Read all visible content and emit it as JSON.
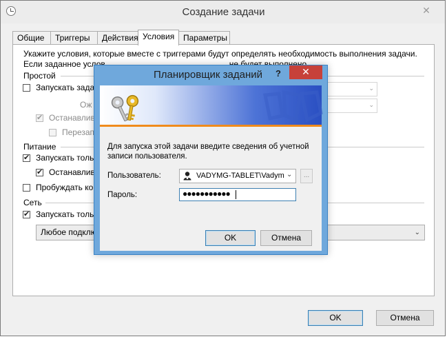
{
  "window": {
    "title": "Создание задачи",
    "close_glyph": "✕"
  },
  "tabs": [
    {
      "label": "Общие"
    },
    {
      "label": "Триггеры"
    },
    {
      "label": "Действия"
    },
    {
      "label": "Условия",
      "active": true
    },
    {
      "label": "Параметры"
    }
  ],
  "conditions": {
    "description_line1": "Укажите условия, которые вместе с триггерами будут определять необходимость выполнения задачи.",
    "description_line2": "Если заданное услов",
    "description_line2_tail": "не будет выполнено",
    "idle": {
      "section": "Простой",
      "start_if_idle": "Запускать задач",
      "wait_label": "Ож",
      "stop_label": "Останавлив",
      "restart_label": "Перезап"
    },
    "power": {
      "section": "Питание",
      "start_on_ac": "Запускать тольк",
      "stop_on_battery": "Останавлив",
      "wake_to_run": "Пробуждать ко"
    },
    "network": {
      "section": "Сеть",
      "start_if_network": "Запускать тольк",
      "connection_value": "Любое подклю"
    }
  },
  "footer": {
    "ok_label": "OK",
    "cancel_label": "Отмена"
  },
  "dialog": {
    "title": "Планировщик заданий",
    "help_glyph": "?",
    "close_glyph": "✕",
    "message": "Для запуска этой задачи введите сведения об учетной записи пользователя.",
    "user_label": "Пользователь:",
    "user_value": "VADYMG-TABLET\\Vadym",
    "browse_label": "...",
    "password_label": "Пароль:",
    "password_value": "●●●●●●●●●●●",
    "ok_label": "OK",
    "cancel_label": "Отмена"
  },
  "colors": {
    "dialog_frame": "#6fa8dc",
    "close_red": "#c7413a",
    "banner_blue": "#2a4fc2",
    "banner_orange": "#f08b1c"
  },
  "icons": {
    "window_icon": "clock-icon",
    "dialog_banner": "keys-icon",
    "user": "user-icon"
  }
}
